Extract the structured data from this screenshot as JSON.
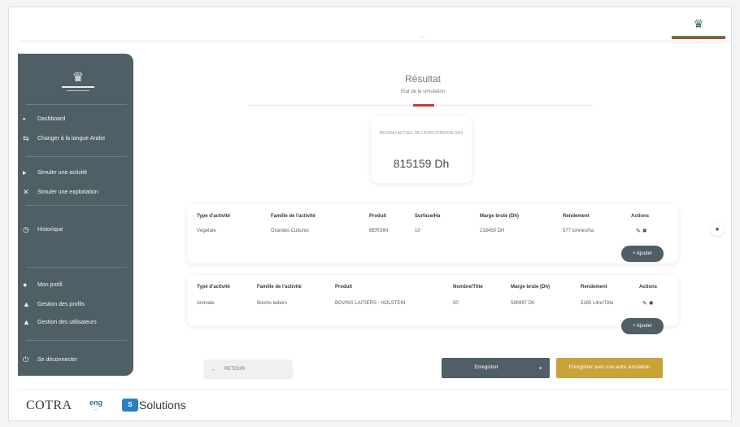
{
  "top_bar": {
    "center_tab": "...",
    "brand_tag": "..."
  },
  "sidebar": {
    "items": [
      {
        "icon": "dashboard-icon",
        "glyph": "▪",
        "label": "Dashboard"
      },
      {
        "icon": "language-icon",
        "glyph": "⇆",
        "label": "Changer à la langue Arabe"
      },
      {
        "icon": "activity-icon",
        "glyph": "▸",
        "label": "Simuler une activité"
      },
      {
        "icon": "farm-icon",
        "glyph": "✕",
        "label": "Simuler une exploitation"
      },
      {
        "icon": "history-icon",
        "glyph": "◷",
        "label": "Historique"
      },
      {
        "icon": "profile-icon",
        "glyph": "●",
        "label": "Mon profil"
      },
      {
        "icon": "profiles-icon",
        "glyph": "▲",
        "label": "Gestion des profils"
      },
      {
        "icon": "users-icon",
        "glyph": "▲",
        "label": "Gestion des utilisateurs"
      },
      {
        "icon": "logout-icon",
        "glyph": "⏻",
        "label": "Se déconnecter"
      }
    ]
  },
  "result": {
    "title": "Résultat",
    "subtitle": "Etat de la simulation"
  },
  "revenue": {
    "label": "REVENU ACTUEL DE L'EXPLOITATION (DH)",
    "value": "815159 Dh"
  },
  "table1": {
    "headers": [
      "Type d'activité",
      "Famille de l'activité",
      "Produit",
      "Surface/Ha",
      "Marge brute (Dh)",
      "Rendement",
      "Actions"
    ],
    "rows": [
      [
        "Végétale",
        "Grandes Cultures",
        "BERSIM",
        "10",
        "218450 DH",
        "577 tonnes/ha"
      ]
    ],
    "actions_label": "✎ ✖",
    "add_label": "+ Ajouter"
  },
  "table2": {
    "headers": [
      "Type d'activité",
      "Famille de l'activité",
      "Produit",
      "Nombre/Tête",
      "Marge brute (Dh)",
      "Rendement",
      "Actions"
    ],
    "rows": [
      [
        "Animale",
        "Bovins laitiers",
        "BOVINS LAITIERS - HOLSTEIN",
        "50",
        "596997 Dh",
        "5185 Litre/Tête"
      ]
    ],
    "actions_label": "✎ ✖",
    "add_label": "+ Ajouter"
  },
  "buttons": {
    "back_icon": "←",
    "back_label": "RETOUR",
    "simulate_label": "Enregistrer",
    "simulate_icon": "💾",
    "export_label": "Enregistrer avec une autre simulation"
  },
  "footer": {
    "logo_cotra": "COTRA",
    "logo_mid_1": "eng",
    "logo_mid_2": "...",
    "logo_solutions_mark": "S",
    "logo_solutions_text": "Solutions"
  },
  "colors": {
    "sidebar": "#4f5f66",
    "accent_red": "#c83a3a",
    "export_gold": "#c9a23a"
  }
}
